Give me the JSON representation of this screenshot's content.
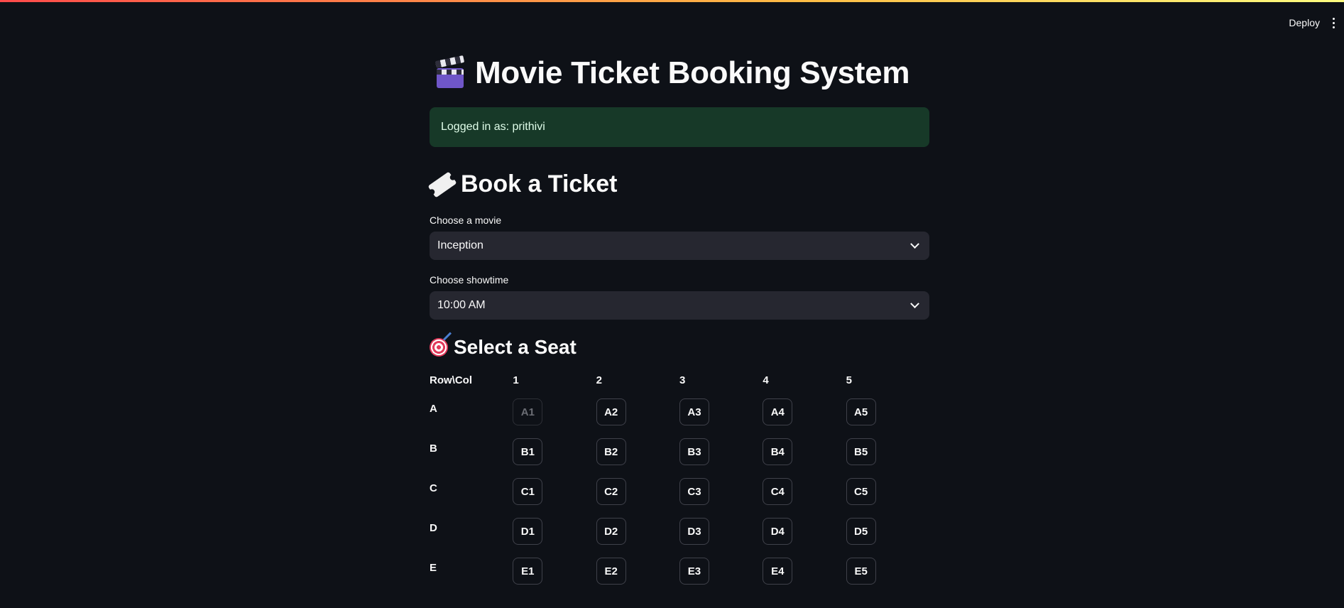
{
  "header": {
    "deploy_label": "Deploy"
  },
  "page": {
    "title": "Movie Ticket Booking System",
    "title_icon": "clapper-board-icon"
  },
  "status": {
    "logged_in_text": "Logged in as: prithivi"
  },
  "booking": {
    "heading": "Book a Ticket",
    "heading_icon": "ticket-icon",
    "movie_label": "Choose a movie",
    "movie_value": "Inception",
    "showtime_label": "Choose showtime",
    "showtime_value": "10:00 AM"
  },
  "seats": {
    "heading": "Select a Seat",
    "heading_icon": "target-icon",
    "corner_label": "Row\\Col",
    "columns": [
      "1",
      "2",
      "3",
      "4",
      "5"
    ],
    "rows": [
      {
        "label": "A",
        "seats": [
          {
            "id": "A1",
            "disabled": true
          },
          {
            "id": "A2"
          },
          {
            "id": "A3"
          },
          {
            "id": "A4"
          },
          {
            "id": "A5"
          }
        ]
      },
      {
        "label": "B",
        "seats": [
          {
            "id": "B1"
          },
          {
            "id": "B2"
          },
          {
            "id": "B3"
          },
          {
            "id": "B4"
          },
          {
            "id": "B5"
          }
        ]
      },
      {
        "label": "C",
        "seats": [
          {
            "id": "C1"
          },
          {
            "id": "C2"
          },
          {
            "id": "C3"
          },
          {
            "id": "C4"
          },
          {
            "id": "C5"
          }
        ]
      },
      {
        "label": "D",
        "seats": [
          {
            "id": "D1"
          },
          {
            "id": "D2"
          },
          {
            "id": "D3"
          },
          {
            "id": "D4"
          },
          {
            "id": "D5"
          }
        ]
      },
      {
        "label": "E",
        "seats": [
          {
            "id": "E1"
          },
          {
            "id": "E2"
          },
          {
            "id": "E3"
          },
          {
            "id": "E4"
          },
          {
            "id": "E5"
          }
        ]
      }
    ]
  },
  "colors": {
    "background": "#0e1117",
    "success_bg": "#173928",
    "select_bg": "#262730",
    "accent": "#ff4b4b"
  }
}
